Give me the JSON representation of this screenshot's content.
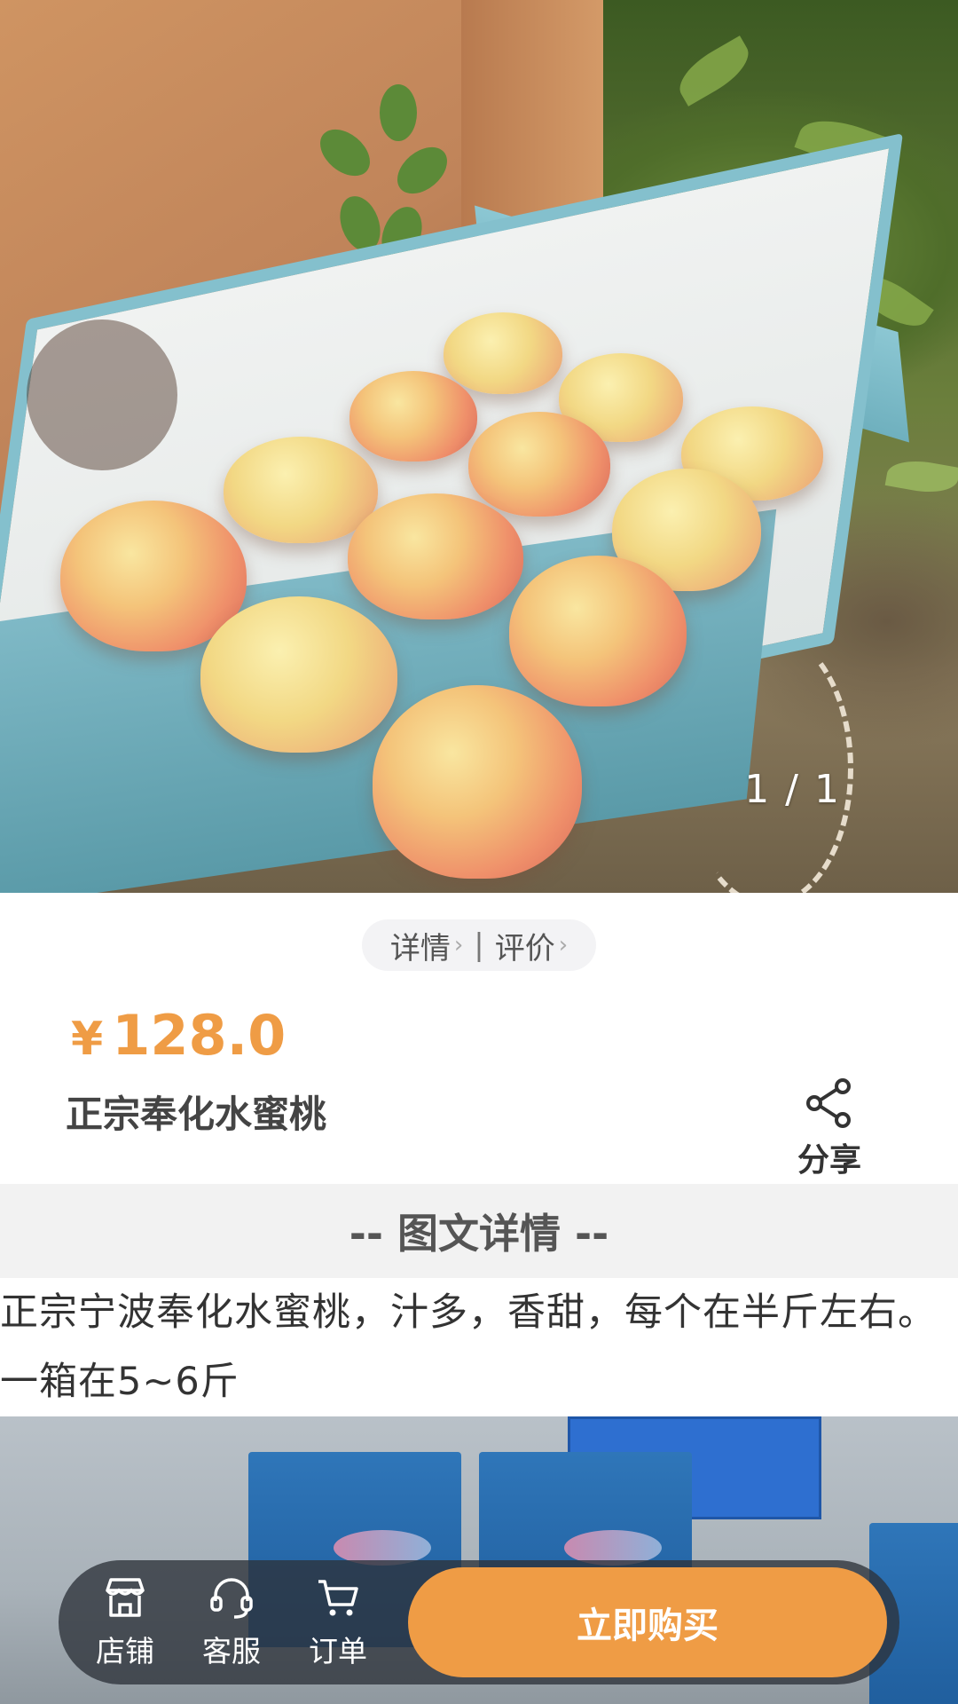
{
  "hero": {
    "counter": "1 / 1"
  },
  "tabs": {
    "detail": "详情",
    "reviews": "评价",
    "separator": "|"
  },
  "product": {
    "currency": "¥",
    "price": "128.0",
    "title": "正宗奉化水蜜桃"
  },
  "share": {
    "label": "分享"
  },
  "section": {
    "title": "-- 图文详情 --"
  },
  "description": "正宗宁波奉化水蜜桃，汁多，香甜，每个在半斤左右。一箱在5~6斤",
  "bottom_bar": {
    "store": "店铺",
    "service": "客服",
    "orders": "订单",
    "buy_now": "立即购买"
  },
  "colors": {
    "accent": "#ef9c45"
  }
}
